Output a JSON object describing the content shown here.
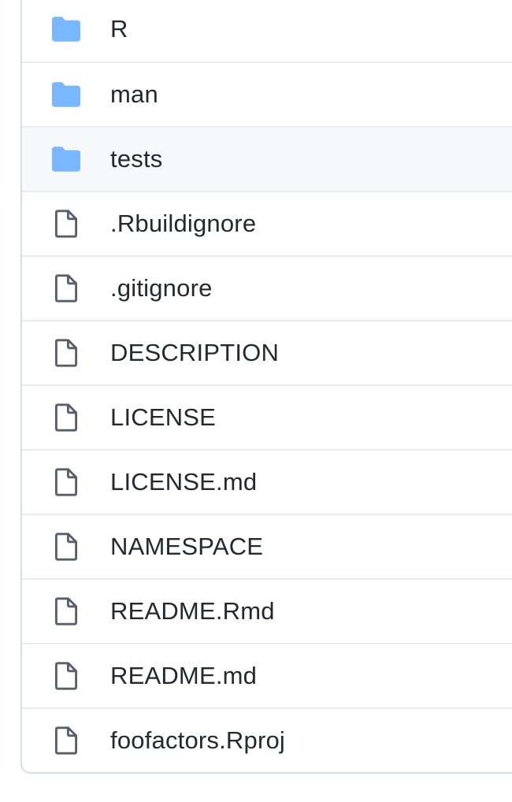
{
  "colors": {
    "folder_icon": "#79b8ff",
    "file_icon": "#57606a",
    "text": "#24292f",
    "row_hover": "#f6f8fa",
    "border": "#d8dee4"
  },
  "files": [
    {
      "name": "R",
      "type": "folder",
      "icon": "folder-icon"
    },
    {
      "name": "man",
      "type": "folder",
      "icon": "folder-icon"
    },
    {
      "name": "tests",
      "type": "folder",
      "icon": "folder-icon",
      "highlighted": true
    },
    {
      "name": ".Rbuildignore",
      "type": "file",
      "icon": "file-icon"
    },
    {
      "name": ".gitignore",
      "type": "file",
      "icon": "file-icon"
    },
    {
      "name": "DESCRIPTION",
      "type": "file",
      "icon": "file-icon"
    },
    {
      "name": "LICENSE",
      "type": "file",
      "icon": "file-icon"
    },
    {
      "name": "LICENSE.md",
      "type": "file",
      "icon": "file-icon"
    },
    {
      "name": "NAMESPACE",
      "type": "file",
      "icon": "file-icon"
    },
    {
      "name": "README.Rmd",
      "type": "file",
      "icon": "file-icon"
    },
    {
      "name": "README.md",
      "type": "file",
      "icon": "file-icon"
    },
    {
      "name": "foofactors.Rproj",
      "type": "file",
      "icon": "file-icon"
    }
  ]
}
